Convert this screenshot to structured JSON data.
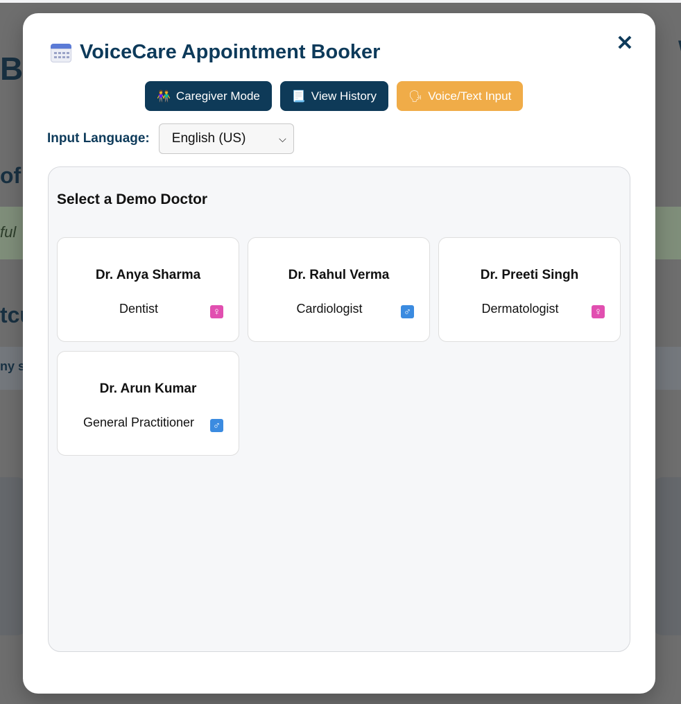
{
  "background": {
    "text_1": "Ba",
    "text_2": "of",
    "text_3": "ful",
    "text_4": "tcu",
    "text_5": "ny s",
    "text_6": "W"
  },
  "modal": {
    "title": "VoiceCare Appointment Booker",
    "close_label": "✕",
    "mode_buttons": [
      {
        "label": "Caregiver Mode",
        "icon": "people-icon",
        "glyph": "👫"
      },
      {
        "label": "View History",
        "icon": "scroll-icon",
        "glyph": "📃"
      },
      {
        "label": "Voice/Text Input",
        "icon": "speaking-head-icon",
        "glyph": "🗣"
      }
    ],
    "language": {
      "label": "Input Language:",
      "selected": "English (US)"
    },
    "panel": {
      "title": "Select a Demo Doctor",
      "doctors": [
        {
          "name": "Dr. Anya Sharma",
          "specialty": "Dentist",
          "gender_glyph": "♀",
          "gender": "female"
        },
        {
          "name": "Dr. Rahul Verma",
          "specialty": "Cardiologist",
          "gender_glyph": "♂",
          "gender": "male"
        },
        {
          "name": "Dr. Preeti Singh",
          "specialty": "Dermatologist",
          "gender_glyph": "♀",
          "gender": "female"
        },
        {
          "name": "Dr. Arun Kumar",
          "specialty": "General Practitioner",
          "gender_glyph": "♂",
          "gender": "male"
        }
      ]
    }
  },
  "colors": {
    "primary": "#0e3a58",
    "accent": "#f0ac48",
    "female": "#e14fb0",
    "male": "#3b8be0"
  }
}
